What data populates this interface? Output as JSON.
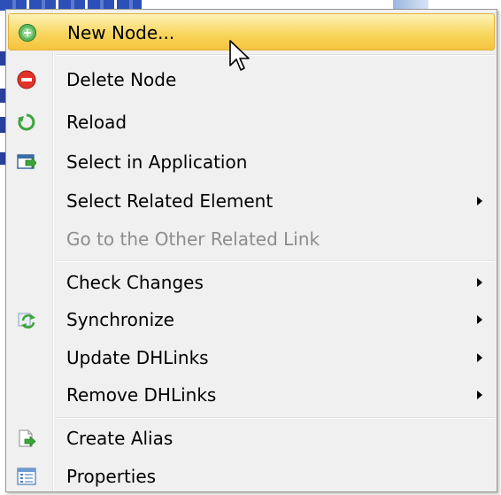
{
  "colors": {
    "menu_background": "#f0f0f0",
    "hover_gradient_top": "#fdf2b8",
    "hover_gradient_bottom": "#f5c43d",
    "disabled_text": "#8d8d8d"
  },
  "menu": {
    "items": [
      {
        "label": "New Node...",
        "icon": "add-circle-icon",
        "hovered": true
      },
      {
        "label": "Delete Node",
        "icon": "delete-circle-icon"
      },
      {
        "label": "Reload",
        "icon": "reload-icon"
      },
      {
        "label": "Select in Application",
        "icon": "select-in-application-icon"
      },
      {
        "label": "Select Related Element",
        "submenu": true
      },
      {
        "label": "Go to the Other Related Link",
        "disabled": true
      },
      {
        "label": "Check Changes",
        "submenu": true
      },
      {
        "label": "Synchronize",
        "icon": "synchronize-icon",
        "submenu": true
      },
      {
        "label": "Update DHLinks",
        "submenu": true
      },
      {
        "label": "Remove DHLinks",
        "submenu": true
      },
      {
        "label": "Create Alias",
        "icon": "create-alias-icon"
      },
      {
        "label": "Properties",
        "icon": "properties-icon"
      }
    ]
  }
}
